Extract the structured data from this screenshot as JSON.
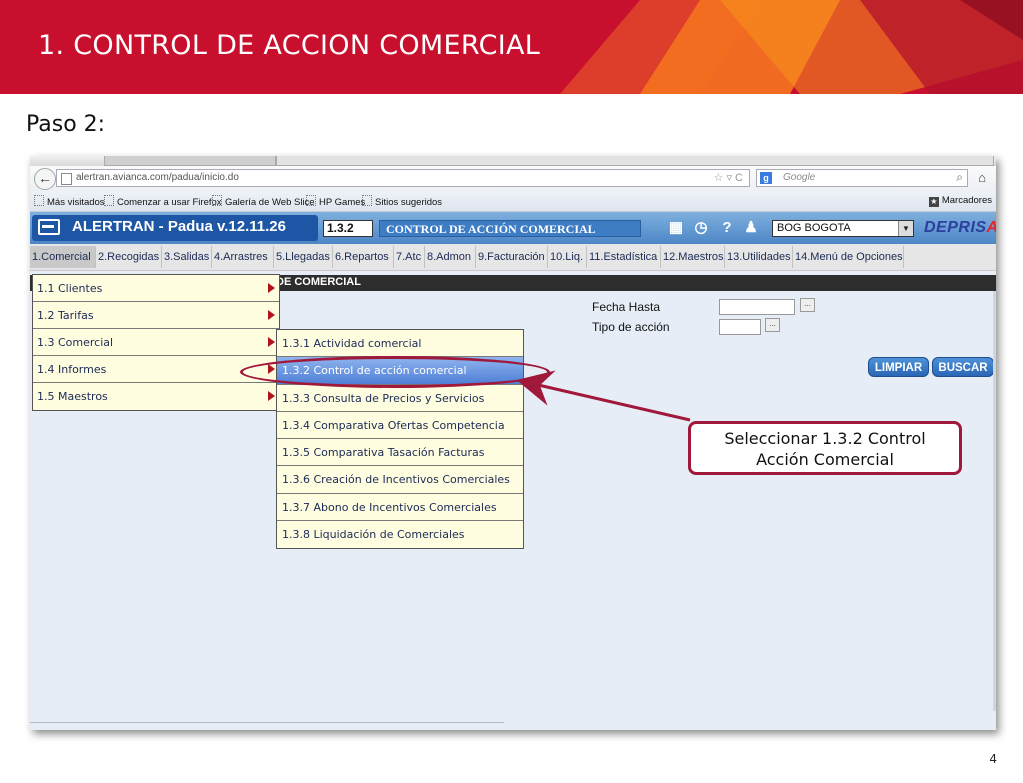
{
  "slide": {
    "title": "1. CONTROL  DE ACCION COMERCIAL",
    "step": "Paso 2:",
    "page_number": "4"
  },
  "colors": {
    "header_red": "#c8102e",
    "header_orange": "#f37021",
    "callout_border": "#a0183a",
    "app_blue": "#1d56a5",
    "menu_cream": "#fffde0"
  },
  "browser": {
    "url": "alertran.avianca.com/padua/inicio.do",
    "search_placeholder": "Google",
    "bookmarks": [
      "Más visitados",
      "Comenzar a usar Firefox",
      "Galería de Web Slice",
      "HP Games",
      "Sitios sugeridos"
    ],
    "bookmarks_right": "Marcadores",
    "icons": [
      "back-icon",
      "star-icon",
      "refresh-icon",
      "search-icon",
      "home-icon"
    ]
  },
  "app": {
    "title": "ALERTRAN - Padua  v.12.11.26",
    "option_code": "1.3.2",
    "option_title": "CONTROL DE ACCIÓN COMERCIAL",
    "office": "BOG BOGOTA",
    "brand_main": "DEPRIS",
    "brand_accent": "A",
    "header_icons": [
      "calculator-icon",
      "clock-icon",
      "help-icon",
      "user-icon"
    ]
  },
  "menu": {
    "items": [
      "1.Comercial",
      "2.Recogidas",
      "3.Salidas",
      "4.Arrastres",
      "5.Llegadas",
      "6.Repartos",
      "7.Atc",
      "8.Admon",
      "9.Facturación",
      "10.Liq.",
      "11.Estadística",
      "12.Maestros",
      "13.Utilidades",
      "14.Menú de Opciones"
    ],
    "active_index": 0
  },
  "form": {
    "section_label": "DE COMERCIAL",
    "fecha_hasta_label": "Fecha Hasta",
    "tipo_accion_label": "Tipo de acción",
    "picker_label": "...",
    "limpiar_label": "LIMPIAR",
    "buscar_label": "BUSCAR"
  },
  "submenu_level1": [
    "1.1 Clientes",
    "1.2 Tarifas",
    "1.3 Comercial",
    "1.4 Informes",
    "1.5 Maestros"
  ],
  "submenu_level2": [
    "1.3.1 Actividad comercial",
    "1.3.2 Control de acción comercial",
    "1.3.3 Consulta de Precios y Servicios",
    "1.3.4 Comparativa Ofertas Competencia",
    "1.3.5 Comparativa Tasación Facturas",
    "1.3.6 Creación de Incentivos Comerciales",
    "1.3.7 Abono de Incentivos Comerciales",
    "1.3.8 Liquidación de Comerciales"
  ],
  "submenu_selected": "1.3.2 Control de acción comercial",
  "callout": {
    "line1": "Seleccionar 1.3.2 Control",
    "line2": "Acción  Comercial"
  }
}
